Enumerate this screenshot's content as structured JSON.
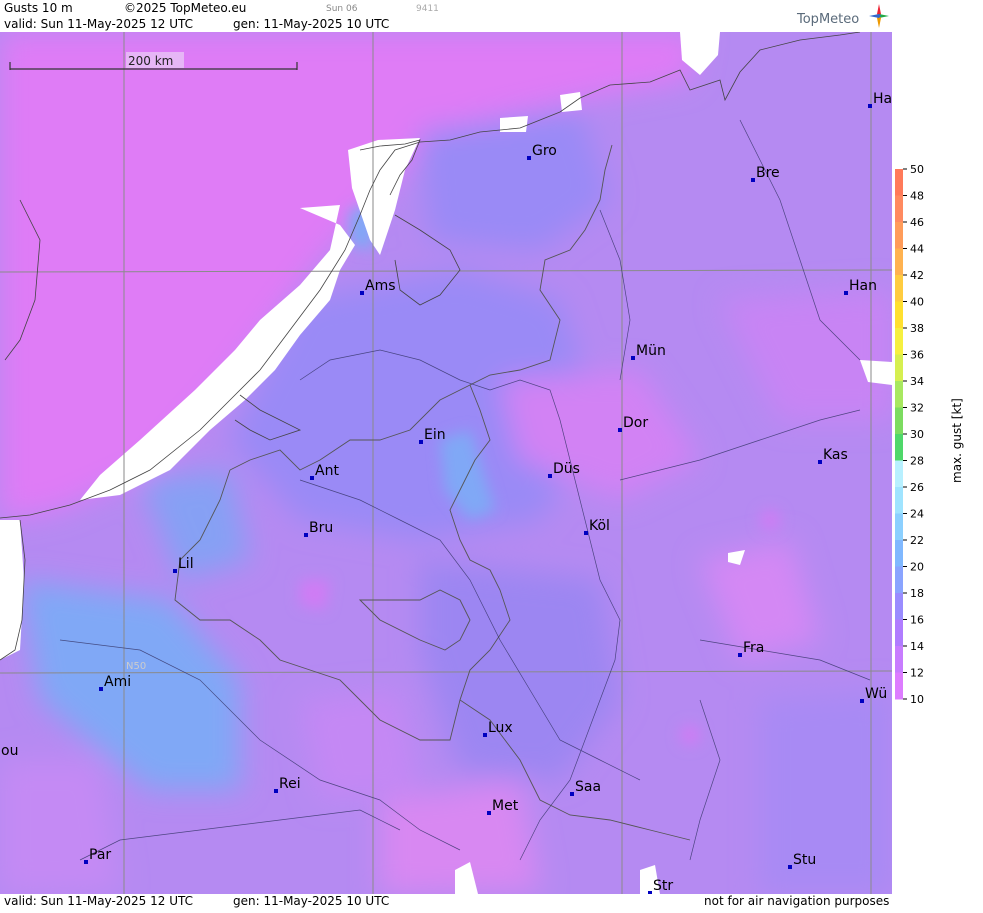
{
  "header": {
    "title": "Gusts 10 m",
    "copyright": "©2025 TopMeteo.eu",
    "run": "Sun 06",
    "id": "9411",
    "valid": "valid:  Sun  11-May-2025  12 UTC",
    "gen": "gen: 11-May-2025 10 UTC",
    "brand": "TopMeteo"
  },
  "footer": {
    "valid": "valid:  Sun  11-May-2025  12 UTC",
    "gen": "gen: 11-May-2025 10 UTC",
    "disclaimer": "not for air navigation purposes"
  },
  "scale": {
    "label": "200 km"
  },
  "graticule": {
    "lat_label": "N50"
  },
  "legend": {
    "title": "max. gust [kt]",
    "ticks": [
      "50",
      "48",
      "46",
      "44",
      "42",
      "40",
      "38",
      "36",
      "34",
      "32",
      "30",
      "28",
      "26",
      "24",
      "22",
      "20",
      "18",
      "16",
      "14",
      "12",
      "10"
    ],
    "colors": [
      "#ff7a5a",
      "#ff8a60",
      "#ff9c5a",
      "#ffb250",
      "#ffcc40",
      "#ffe030",
      "#f6f040",
      "#d6ef50",
      "#a8e860",
      "#7cdc60",
      "#4fd86a",
      "#b8f0ff",
      "#a0e4ff",
      "#8cd0ff",
      "#80b8ff",
      "#8aa4ff",
      "#9a8cff",
      "#b07cff",
      "#c87cff",
      "#dd7cff"
    ]
  },
  "cities": [
    {
      "name": "Gro"
    },
    {
      "name": "Bre"
    },
    {
      "name": "Ha"
    },
    {
      "name": "Ams"
    },
    {
      "name": "Han"
    },
    {
      "name": "Mün"
    },
    {
      "name": "Dor"
    },
    {
      "name": "Ein"
    },
    {
      "name": "Kas"
    },
    {
      "name": "Ant"
    },
    {
      "name": "Düs"
    },
    {
      "name": "Köl"
    },
    {
      "name": "Bru"
    },
    {
      "name": "Lil"
    },
    {
      "name": "Fra"
    },
    {
      "name": "Ami"
    },
    {
      "name": "Wü"
    },
    {
      "name": "Lux"
    },
    {
      "name": "ou"
    },
    {
      "name": "Rei"
    },
    {
      "name": "Saa"
    },
    {
      "name": "Met"
    },
    {
      "name": "Par"
    },
    {
      "name": "Stu"
    },
    {
      "name": "Str"
    }
  ],
  "colors": {
    "base": "#b58af2",
    "coast": "#444444",
    "city_dot": "#0000c0"
  }
}
